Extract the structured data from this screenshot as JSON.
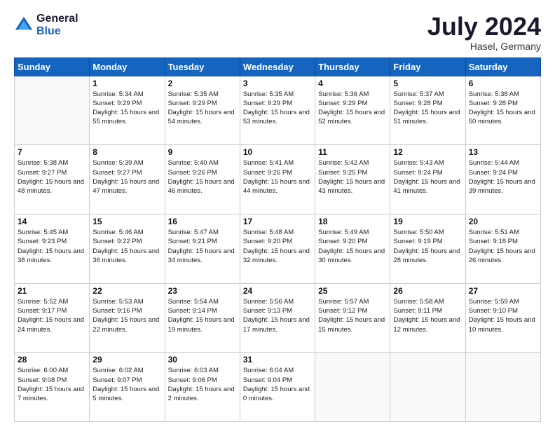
{
  "header": {
    "logo_line1": "General",
    "logo_line2": "Blue",
    "month": "July 2024",
    "location": "Hasel, Germany"
  },
  "days_of_week": [
    "Sunday",
    "Monday",
    "Tuesday",
    "Wednesday",
    "Thursday",
    "Friday",
    "Saturday"
  ],
  "weeks": [
    [
      {
        "day": "",
        "sunrise": "",
        "sunset": "",
        "daylight": ""
      },
      {
        "day": "1",
        "sunrise": "Sunrise: 5:34 AM",
        "sunset": "Sunset: 9:29 PM",
        "daylight": "Daylight: 15 hours and 55 minutes."
      },
      {
        "day": "2",
        "sunrise": "Sunrise: 5:35 AM",
        "sunset": "Sunset: 9:29 PM",
        "daylight": "Daylight: 15 hours and 54 minutes."
      },
      {
        "day": "3",
        "sunrise": "Sunrise: 5:35 AM",
        "sunset": "Sunset: 9:29 PM",
        "daylight": "Daylight: 15 hours and 53 minutes."
      },
      {
        "day": "4",
        "sunrise": "Sunrise: 5:36 AM",
        "sunset": "Sunset: 9:29 PM",
        "daylight": "Daylight: 15 hours and 52 minutes."
      },
      {
        "day": "5",
        "sunrise": "Sunrise: 5:37 AM",
        "sunset": "Sunset: 9:28 PM",
        "daylight": "Daylight: 15 hours and 51 minutes."
      },
      {
        "day": "6",
        "sunrise": "Sunrise: 5:38 AM",
        "sunset": "Sunset: 9:28 PM",
        "daylight": "Daylight: 15 hours and 50 minutes."
      }
    ],
    [
      {
        "day": "7",
        "sunrise": "Sunrise: 5:38 AM",
        "sunset": "Sunset: 9:27 PM",
        "daylight": "Daylight: 15 hours and 48 minutes."
      },
      {
        "day": "8",
        "sunrise": "Sunrise: 5:39 AM",
        "sunset": "Sunset: 9:27 PM",
        "daylight": "Daylight: 15 hours and 47 minutes."
      },
      {
        "day": "9",
        "sunrise": "Sunrise: 5:40 AM",
        "sunset": "Sunset: 9:26 PM",
        "daylight": "Daylight: 15 hours and 46 minutes."
      },
      {
        "day": "10",
        "sunrise": "Sunrise: 5:41 AM",
        "sunset": "Sunset: 9:26 PM",
        "daylight": "Daylight: 15 hours and 44 minutes."
      },
      {
        "day": "11",
        "sunrise": "Sunrise: 5:42 AM",
        "sunset": "Sunset: 9:25 PM",
        "daylight": "Daylight: 15 hours and 43 minutes."
      },
      {
        "day": "12",
        "sunrise": "Sunrise: 5:43 AM",
        "sunset": "Sunset: 9:24 PM",
        "daylight": "Daylight: 15 hours and 41 minutes."
      },
      {
        "day": "13",
        "sunrise": "Sunrise: 5:44 AM",
        "sunset": "Sunset: 9:24 PM",
        "daylight": "Daylight: 15 hours and 39 minutes."
      }
    ],
    [
      {
        "day": "14",
        "sunrise": "Sunrise: 5:45 AM",
        "sunset": "Sunset: 9:23 PM",
        "daylight": "Daylight: 15 hours and 38 minutes."
      },
      {
        "day": "15",
        "sunrise": "Sunrise: 5:46 AM",
        "sunset": "Sunset: 9:22 PM",
        "daylight": "Daylight: 15 hours and 36 minutes."
      },
      {
        "day": "16",
        "sunrise": "Sunrise: 5:47 AM",
        "sunset": "Sunset: 9:21 PM",
        "daylight": "Daylight: 15 hours and 34 minutes."
      },
      {
        "day": "17",
        "sunrise": "Sunrise: 5:48 AM",
        "sunset": "Sunset: 9:20 PM",
        "daylight": "Daylight: 15 hours and 32 minutes."
      },
      {
        "day": "18",
        "sunrise": "Sunrise: 5:49 AM",
        "sunset": "Sunset: 9:20 PM",
        "daylight": "Daylight: 15 hours and 30 minutes."
      },
      {
        "day": "19",
        "sunrise": "Sunrise: 5:50 AM",
        "sunset": "Sunset: 9:19 PM",
        "daylight": "Daylight: 15 hours and 28 minutes."
      },
      {
        "day": "20",
        "sunrise": "Sunrise: 5:51 AM",
        "sunset": "Sunset: 9:18 PM",
        "daylight": "Daylight: 15 hours and 26 minutes."
      }
    ],
    [
      {
        "day": "21",
        "sunrise": "Sunrise: 5:52 AM",
        "sunset": "Sunset: 9:17 PM",
        "daylight": "Daylight: 15 hours and 24 minutes."
      },
      {
        "day": "22",
        "sunrise": "Sunrise: 5:53 AM",
        "sunset": "Sunset: 9:16 PM",
        "daylight": "Daylight: 15 hours and 22 minutes."
      },
      {
        "day": "23",
        "sunrise": "Sunrise: 5:54 AM",
        "sunset": "Sunset: 9:14 PM",
        "daylight": "Daylight: 15 hours and 19 minutes."
      },
      {
        "day": "24",
        "sunrise": "Sunrise: 5:56 AM",
        "sunset": "Sunset: 9:13 PM",
        "daylight": "Daylight: 15 hours and 17 minutes."
      },
      {
        "day": "25",
        "sunrise": "Sunrise: 5:57 AM",
        "sunset": "Sunset: 9:12 PM",
        "daylight": "Daylight: 15 hours and 15 minutes."
      },
      {
        "day": "26",
        "sunrise": "Sunrise: 5:58 AM",
        "sunset": "Sunset: 9:11 PM",
        "daylight": "Daylight: 15 hours and 12 minutes."
      },
      {
        "day": "27",
        "sunrise": "Sunrise: 5:59 AM",
        "sunset": "Sunset: 9:10 PM",
        "daylight": "Daylight: 15 hours and 10 minutes."
      }
    ],
    [
      {
        "day": "28",
        "sunrise": "Sunrise: 6:00 AM",
        "sunset": "Sunset: 9:08 PM",
        "daylight": "Daylight: 15 hours and 7 minutes."
      },
      {
        "day": "29",
        "sunrise": "Sunrise: 6:02 AM",
        "sunset": "Sunset: 9:07 PM",
        "daylight": "Daylight: 15 hours and 5 minutes."
      },
      {
        "day": "30",
        "sunrise": "Sunrise: 6:03 AM",
        "sunset": "Sunset: 9:06 PM",
        "daylight": "Daylight: 15 hours and 2 minutes."
      },
      {
        "day": "31",
        "sunrise": "Sunrise: 6:04 AM",
        "sunset": "Sunset: 9:04 PM",
        "daylight": "Daylight: 15 hours and 0 minutes."
      },
      {
        "day": "",
        "sunrise": "",
        "sunset": "",
        "daylight": ""
      },
      {
        "day": "",
        "sunrise": "",
        "sunset": "",
        "daylight": ""
      },
      {
        "day": "",
        "sunrise": "",
        "sunset": "",
        "daylight": ""
      }
    ]
  ]
}
